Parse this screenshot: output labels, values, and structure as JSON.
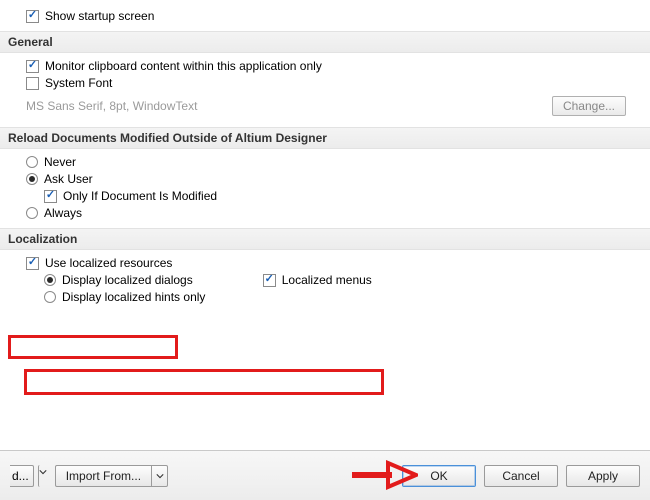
{
  "top": {
    "show_startup_label": "Show startup screen",
    "show_startup_checked": true
  },
  "general": {
    "header": "General",
    "monitor_clipboard_label": "Monitor clipboard content within this application only",
    "monitor_clipboard_checked": true,
    "system_font_label": "System Font",
    "system_font_checked": false,
    "font_sample": "MS Sans Serif, 8pt, WindowText",
    "change_btn": "Change..."
  },
  "reload": {
    "header": "Reload Documents Modified Outside of Altium Designer",
    "never_label": "Never",
    "ask_label": "Ask User",
    "only_if_label": "Only If Document Is Modified",
    "only_if_checked": true,
    "always_label": "Always",
    "selected": "ask"
  },
  "localization": {
    "header": "Localization",
    "use_localized_label": "Use localized resources",
    "use_localized_checked": true,
    "display_dialogs_label": "Display localized dialogs",
    "localized_menus_label": "Localized menus",
    "localized_menus_checked": true,
    "display_hints_label": "Display localized hints only",
    "sub_selected": "dialogs"
  },
  "footer": {
    "truncated_label": "d...",
    "import_label": "Import From...",
    "ok": "OK",
    "cancel": "Cancel",
    "apply": "Apply"
  }
}
